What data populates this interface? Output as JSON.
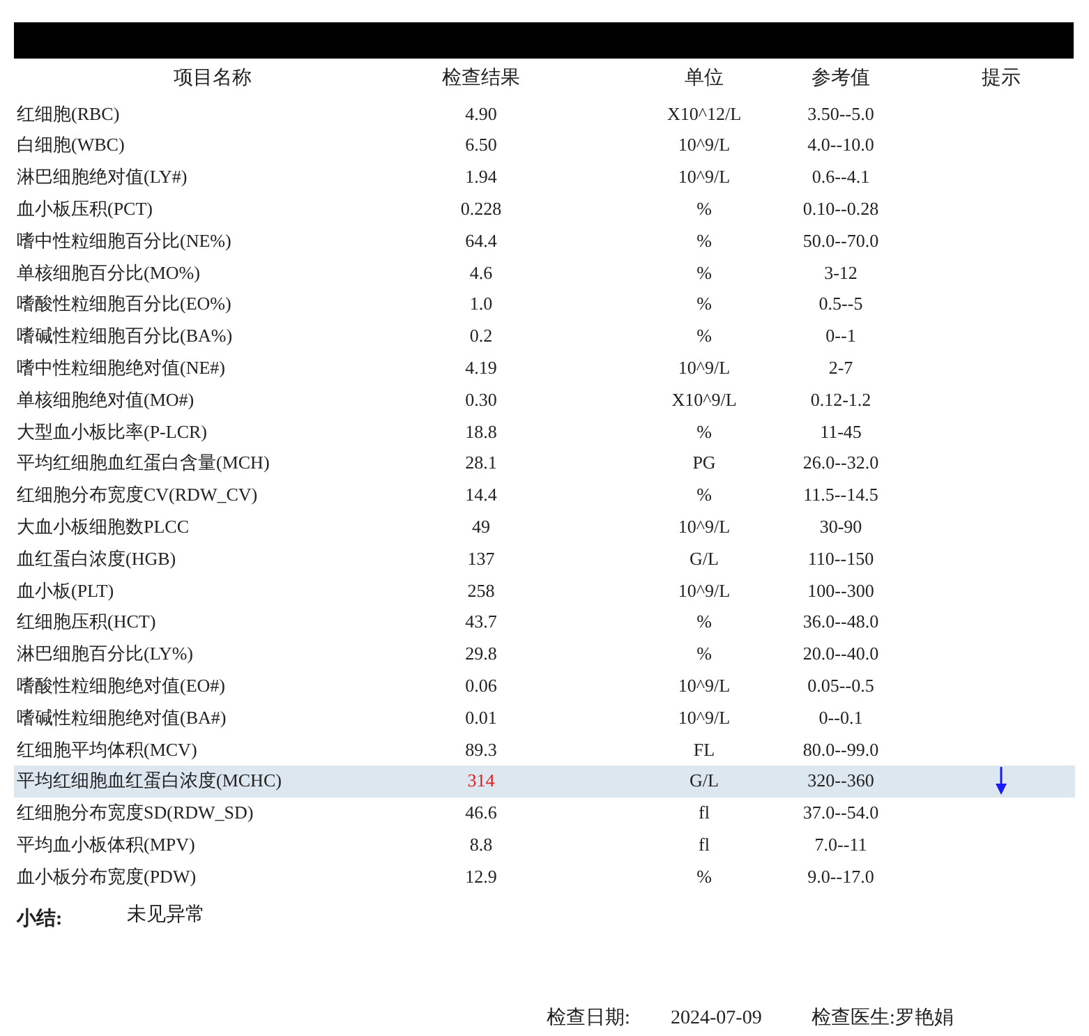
{
  "table": {
    "columns": [
      "项目名称",
      "检查结果",
      "单位",
      "参考值",
      "提示"
    ],
    "rows": [
      {
        "name": "红细胞(RBC)",
        "result": "4.90",
        "unit": "X10^12/L",
        "reference": "3.50--5.0",
        "low": false,
        "selected": false
      },
      {
        "name": "白细胞(WBC)",
        "result": "6.50",
        "unit": "10^9/L",
        "reference": "4.0--10.0",
        "low": false,
        "selected": false
      },
      {
        "name": "淋巴细胞绝对值(LY#)",
        "result": "1.94",
        "unit": "10^9/L",
        "reference": "0.6--4.1",
        "low": false,
        "selected": false
      },
      {
        "name": "血小板压积(PCT)",
        "result": "0.228",
        "unit": "%",
        "reference": "0.10--0.28",
        "low": false,
        "selected": false
      },
      {
        "name": "嗜中性粒细胞百分比(NE%)",
        "result": "64.4",
        "unit": "%",
        "reference": "50.0--70.0",
        "low": false,
        "selected": false
      },
      {
        "name": "单核细胞百分比(MO%)",
        "result": "4.6",
        "unit": "%",
        "reference": "3-12",
        "low": false,
        "selected": false
      },
      {
        "name": "嗜酸性粒细胞百分比(EO%)",
        "result": "1.0",
        "unit": "%",
        "reference": "0.5--5",
        "low": false,
        "selected": false
      },
      {
        "name": "嗜碱性粒细胞百分比(BA%)",
        "result": "0.2",
        "unit": "%",
        "reference": "0--1",
        "low": false,
        "selected": false
      },
      {
        "name": "嗜中性粒细胞绝对值(NE#)",
        "result": "4.19",
        "unit": "10^9/L",
        "reference": "2-7",
        "low": false,
        "selected": false
      },
      {
        "name": "单核细胞绝对值(MO#)",
        "result": "0.30",
        "unit": "X10^9/L",
        "reference": "0.12-1.2",
        "low": false,
        "selected": false
      },
      {
        "name": "大型血小板比率(P-LCR)",
        "result": "18.8",
        "unit": "%",
        "reference": "11-45",
        "low": false,
        "selected": false
      },
      {
        "name": "平均红细胞血红蛋白含量(MCH)",
        "result": "28.1",
        "unit": "PG",
        "reference": "26.0--32.0",
        "low": false,
        "selected": false
      },
      {
        "name": "红细胞分布宽度CV(RDW_CV)",
        "result": "14.4",
        "unit": "%",
        "reference": "11.5--14.5",
        "low": false,
        "selected": false
      },
      {
        "name": "大血小板细胞数PLCC",
        "result": "49",
        "unit": "10^9/L",
        "reference": "30-90",
        "low": false,
        "selected": false
      },
      {
        "name": "血红蛋白浓度(HGB)",
        "result": "137",
        "unit": "G/L",
        "reference": "110--150",
        "low": false,
        "selected": false
      },
      {
        "name": "血小板(PLT)",
        "result": "258",
        "unit": "10^9/L",
        "reference": "100--300",
        "low": false,
        "selected": false
      },
      {
        "name": "红细胞压积(HCT)",
        "result": "43.7",
        "unit": "%",
        "reference": "36.0--48.0",
        "low": false,
        "selected": false
      },
      {
        "name": "淋巴细胞百分比(LY%)",
        "result": "29.8",
        "unit": "%",
        "reference": "20.0--40.0",
        "low": false,
        "selected": false
      },
      {
        "name": "嗜酸性粒细胞绝对值(EO#)",
        "result": "0.06",
        "unit": "10^9/L",
        "reference": "0.05--0.5",
        "low": false,
        "selected": false
      },
      {
        "name": "嗜碱性粒细胞绝对值(BA#)",
        "result": "0.01",
        "unit": "10^9/L",
        "reference": "0--0.1",
        "low": false,
        "selected": false
      },
      {
        "name": "红细胞平均体积(MCV)",
        "result": "89.3",
        "unit": "FL",
        "reference": "80.0--99.0",
        "low": false,
        "selected": false
      },
      {
        "name": "平均红细胞血红蛋白浓度(MCHC)",
        "result": "314",
        "unit": "G/L",
        "reference": "320--360",
        "low": true,
        "selected": true
      },
      {
        "name": "红细胞分布宽度SD(RDW_SD)",
        "result": "46.6",
        "unit": "fl",
        "reference": "37.0--54.0",
        "low": false,
        "selected": false
      },
      {
        "name": "平均血小板体积(MPV)",
        "result": "8.8",
        "unit": "fl",
        "reference": "7.0--11",
        "low": false,
        "selected": false
      },
      {
        "name": "血小板分布宽度(PDW)",
        "result": "12.9",
        "unit": "%",
        "reference": "9.0--17.0",
        "low": false,
        "selected": false
      }
    ]
  },
  "summary": {
    "label": "小结:",
    "text": "未见异常"
  },
  "footer": {
    "date_label": "检查日期:",
    "date": "2024-07-09",
    "doctor": "检查医生:罗艳娟"
  }
}
